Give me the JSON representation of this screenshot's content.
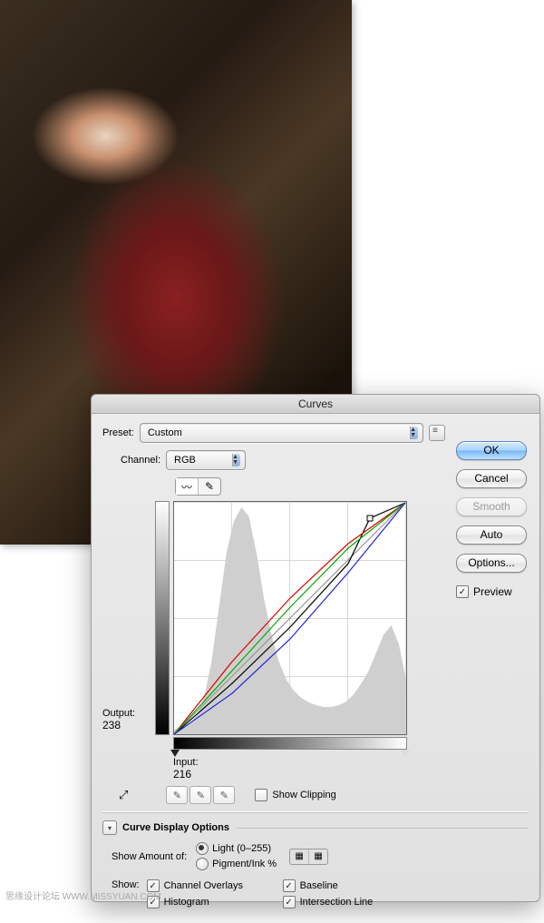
{
  "dialog": {
    "title": "Curves",
    "preset_label": "Preset:",
    "preset_value": "Custom",
    "channel_label": "Channel:",
    "channel_value": "RGB",
    "output_label": "Output:",
    "output_value": "238",
    "input_label": "Input:",
    "input_value": "216",
    "show_clipping": "Show Clipping",
    "curve_display": "Curve Display Options",
    "show_amount": "Show Amount of:",
    "light": "Light  (0–255)",
    "pigment": "Pigment/Ink %",
    "show_label": "Show:",
    "ch_overlays": "Channel Overlays",
    "baseline": "Baseline",
    "histogram": "Histogram",
    "intersection": "Intersection Line"
  },
  "buttons": {
    "ok": "OK",
    "cancel": "Cancel",
    "smooth": "Smooth",
    "auto": "Auto",
    "options": "Options...",
    "preview": "Preview"
  },
  "watermark": "思缘设计论坛  WWW.MISSYUAN.COM",
  "chart_data": {
    "type": "line",
    "title": "Curves",
    "xlabel": "Input",
    "ylabel": "Output",
    "xlim": [
      0,
      255
    ],
    "ylim": [
      0,
      255
    ],
    "series": [
      {
        "name": "Baseline",
        "color": "#999",
        "x": [
          0,
          255
        ],
        "y": [
          0,
          255
        ]
      },
      {
        "name": "RGB",
        "color": "#000",
        "x": [
          0,
          64,
          128,
          192,
          216,
          255
        ],
        "y": [
          0,
          56,
          118,
          188,
          238,
          255
        ]
      },
      {
        "name": "Red",
        "color": "#d00",
        "x": [
          0,
          64,
          128,
          192,
          255
        ],
        "y": [
          0,
          80,
          150,
          210,
          255
        ]
      },
      {
        "name": "Green",
        "color": "#0a0",
        "x": [
          0,
          64,
          128,
          192,
          255
        ],
        "y": [
          0,
          70,
          140,
          205,
          255
        ]
      },
      {
        "name": "Blue",
        "color": "#22d",
        "x": [
          0,
          64,
          128,
          192,
          255
        ],
        "y": [
          0,
          45,
          105,
          178,
          255
        ]
      }
    ],
    "active_point": {
      "input": 216,
      "output": 238
    },
    "histogram": [
      5,
      8,
      12,
      20,
      40,
      80,
      140,
      200,
      235,
      250,
      240,
      200,
      150,
      110,
      80,
      60,
      48,
      40,
      35,
      32,
      30,
      30,
      32,
      36,
      44,
      56,
      70,
      90,
      110,
      120,
      100,
      60
    ]
  }
}
